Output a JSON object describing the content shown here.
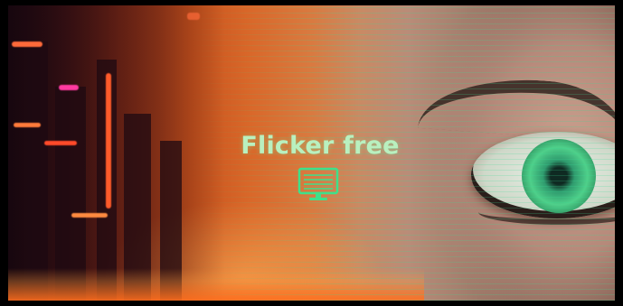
{
  "banner": {
    "headline": "Flicker free",
    "feature_icon": "monitor-icon"
  },
  "colors": {
    "accent_green": "#3fe08a",
    "headline_text": "#b9f0bf",
    "warm_glow": "#d9682a"
  }
}
